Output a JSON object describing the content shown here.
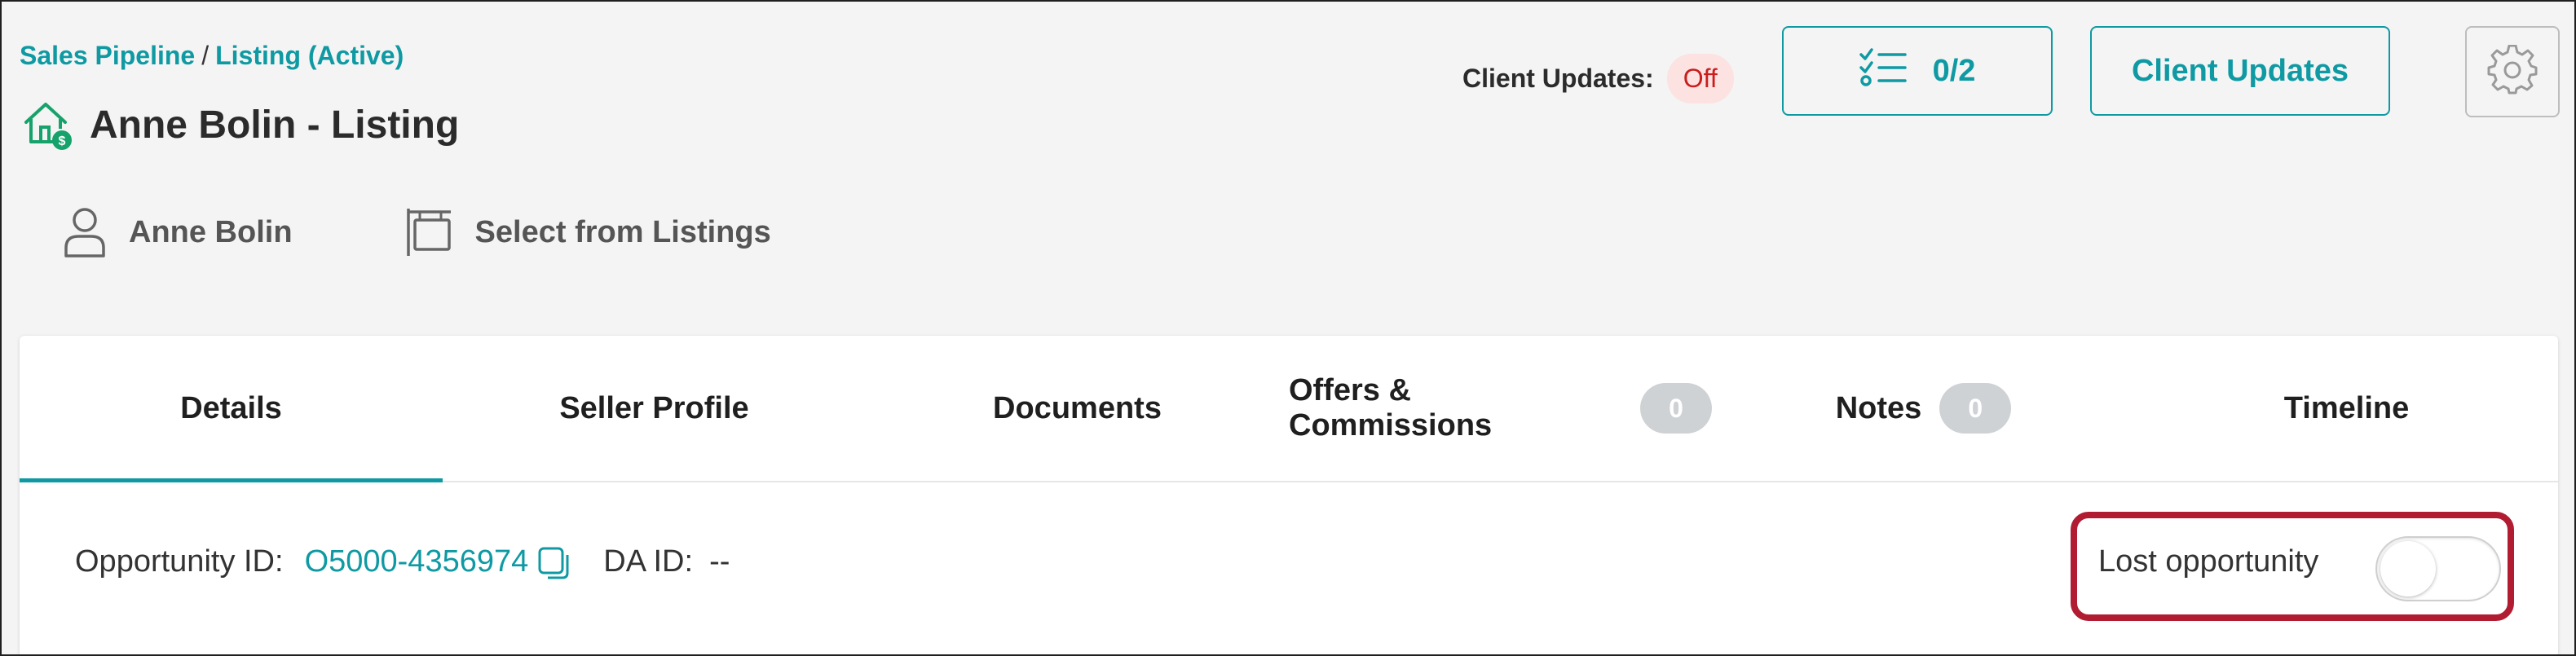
{
  "breadcrumb": {
    "items": [
      "Sales Pipeline",
      "Listing (Active)"
    ],
    "separator": "/"
  },
  "header": {
    "title": "Anne Bolin - Listing",
    "icon": "house-dollar-icon"
  },
  "meta": {
    "contact_name": "Anne Bolin",
    "listing_select": "Select from Listings"
  },
  "top_right": {
    "client_updates_label": "Client Updates:",
    "client_updates_status": "Off",
    "tasks_count": "0/2",
    "client_updates_button": "Client Updates",
    "settings_icon": "gear-icon"
  },
  "tabs": [
    {
      "label": "Details",
      "active": true
    },
    {
      "label": "Seller Profile"
    },
    {
      "label": "Documents"
    },
    {
      "label": "Offers & Commissions",
      "badge": "0"
    },
    {
      "label": "Notes",
      "badge": "0"
    },
    {
      "label": "Timeline"
    }
  ],
  "details": {
    "opportunity_label": "Opportunity ID:",
    "opportunity_id": "O5000-4356974",
    "da_label": "DA ID:",
    "da_value": "--",
    "lost_label": "Lost opportunity",
    "lost_value": false
  },
  "colors": {
    "accent": "#0f9aa3",
    "highlight": "#b11c33",
    "off_bg": "#fde2e2",
    "off_text": "#c81e1e"
  }
}
